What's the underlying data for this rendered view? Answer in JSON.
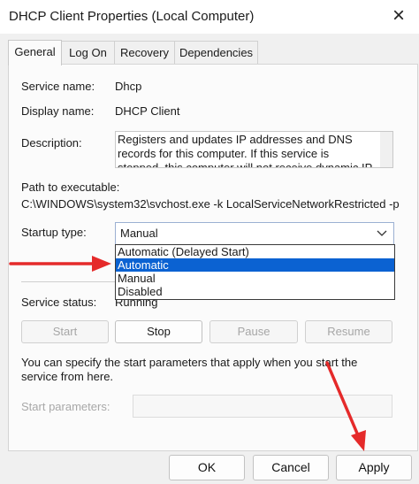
{
  "window": {
    "title": "DHCP Client Properties (Local Computer)",
    "close_glyph": "×"
  },
  "tabs": [
    {
      "label": "General",
      "active": true
    },
    {
      "label": "Log On",
      "active": false
    },
    {
      "label": "Recovery",
      "active": false
    },
    {
      "label": "Dependencies",
      "active": false
    }
  ],
  "general": {
    "service_name_label": "Service name:",
    "service_name": "Dhcp",
    "display_name_label": "Display name:",
    "display_name": "DHCP Client",
    "description_label": "Description:",
    "description": "Registers and updates IP addresses and DNS records for this computer. If this service is stopped, this computer will not receive dynamic IP addresses",
    "path_label": "Path to executable:",
    "path": "C:\\WINDOWS\\system32\\svchost.exe -k LocalServiceNetworkRestricted -p",
    "startup_type_label": "Startup type:",
    "startup_type_value": "Manual",
    "startup_options": [
      {
        "label": "Automatic (Delayed Start)",
        "selected": false
      },
      {
        "label": "Automatic",
        "selected": true
      },
      {
        "label": "Manual",
        "selected": false
      },
      {
        "label": "Disabled",
        "selected": false
      }
    ],
    "service_status_label": "Service status:",
    "service_status": "Running",
    "buttons": {
      "start": "Start",
      "stop": "Stop",
      "pause": "Pause",
      "resume": "Resume"
    },
    "start_params_note": "You can specify the start parameters that apply when you start the service from here.",
    "start_params_label": "Start parameters:",
    "start_params_value": ""
  },
  "footer": {
    "ok": "OK",
    "cancel": "Cancel",
    "apply": "Apply"
  },
  "colors": {
    "selection": "#0b62d2",
    "annotation_arrow": "#e52a2a"
  }
}
